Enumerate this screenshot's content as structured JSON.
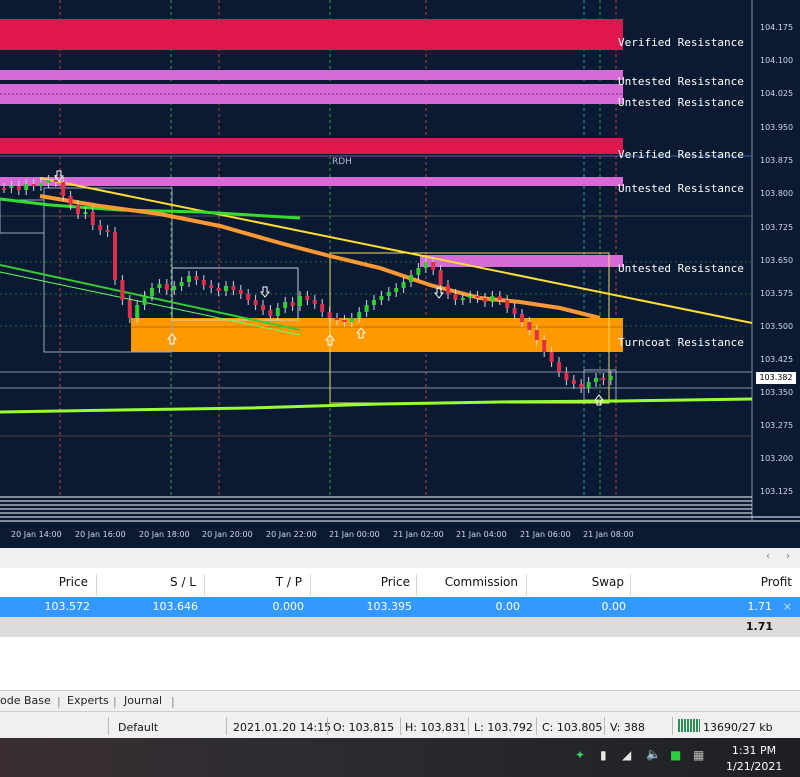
{
  "chart": {
    "background": "#0b1a33",
    "symbol_label": "RDH",
    "current_price": "103.382",
    "price_ticks": [
      "104.175",
      "104.100",
      "104.025",
      "103.950",
      "103.875",
      "103.800",
      "103.725",
      "103.650",
      "103.575",
      "103.500",
      "103.425",
      "103.350",
      "103.275",
      "103.200",
      "103.125"
    ],
    "time_ticks": [
      "20 Jan 14:00",
      "20 Jan 16:00",
      "20 Jan 18:00",
      "20 Jan 20:00",
      "20 Jan 22:00",
      "21 Jan 00:00",
      "21 Jan 02:00",
      "21 Jan 04:00",
      "21 Jan 06:00",
      "21 Jan 08:00"
    ],
    "zones": [
      {
        "label": "Verified Resistance",
        "color": "#e0174f"
      },
      {
        "label": "Untested Resistance",
        "color": "#d86ad8"
      },
      {
        "label": "Untested Resistance",
        "color": "#d86ad8"
      },
      {
        "label": "Verified Resistance",
        "color": "#e0174f"
      },
      {
        "label": "Untested Resistance",
        "color": "#d86ad8"
      },
      {
        "label": "Untested Resistance",
        "color": "#d86ad8"
      },
      {
        "label": "Turncoat Resistance",
        "color": "#ff9900"
      }
    ]
  },
  "terminal": {
    "headers": [
      "Price",
      "S / L",
      "T / P",
      "Price",
      "Commission",
      "Swap",
      "Profit"
    ],
    "row": [
      "103.572",
      "103.646",
      "0.000",
      "103.395",
      "0.00",
      "0.00",
      "1.71"
    ],
    "close_icon": "×",
    "total": "1.71"
  },
  "tabs": [
    "ode Base",
    "Experts",
    "Journal"
  ],
  "status": {
    "profile": "Default",
    "datetime": "2021.01.20 14:15",
    "open": "O: 103.815",
    "high": "H: 103.831",
    "low": "L: 103.792",
    "close": "C: 103.805",
    "volume": "V: 388",
    "traffic": "13690/27 kb"
  },
  "taskbar": {
    "time": "1:31 PM",
    "date": "1/21/2021"
  }
}
